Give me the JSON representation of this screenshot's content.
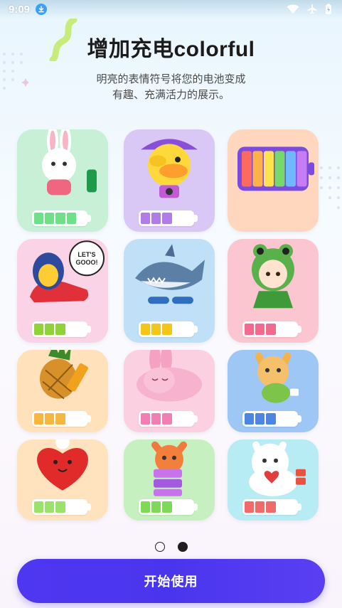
{
  "status_bar": {
    "time": "9:09",
    "icons": [
      "download-icon",
      "wifi-icon",
      "airplane-icon",
      "battery-charging-icon"
    ]
  },
  "header": {
    "title": "增加充电colorful",
    "subtitle_line1": "明亮的表情符号将您的电池变成",
    "subtitle_line2": "有趣、充满活力的展示。"
  },
  "gallery": {
    "cards": [
      {
        "name": "bunny",
        "bg": "#c8f0d6",
        "level": 0.7,
        "color": "#6fe08a"
      },
      {
        "name": "duck",
        "bg": "#d9c7f5",
        "level": 0.55,
        "color": "#b27ce8"
      },
      {
        "name": "rainbow-battery",
        "bg": "#ffd7bf",
        "level": 1.0,
        "color": "#ff7a5c"
      },
      {
        "name": "penguin-sneaker",
        "bg": "#fbd3e6",
        "level": 0.6,
        "color": "#8fd23a"
      },
      {
        "name": "shark",
        "bg": "#bfe0f7",
        "level": 0.6,
        "color": "#f6c51a"
      },
      {
        "name": "frog-girl",
        "bg": "#fbc6cf",
        "level": 0.6,
        "color": "#f26a8d"
      },
      {
        "name": "pineapple",
        "bg": "#ffe2bb",
        "level": 0.6,
        "color": "#f7b640"
      },
      {
        "name": "sleeping-bunny",
        "bg": "#fbd1e2",
        "level": 0.6,
        "color": "#f17fb4"
      },
      {
        "name": "cat-teapot",
        "bg": "#9fc7f5",
        "level": 0.6,
        "color": "#4b86e2"
      },
      {
        "name": "heart",
        "bg": "#ffe3bf",
        "level": 0.6,
        "color": "#9be26b"
      },
      {
        "name": "orange-cat",
        "bg": "#c6f0c0",
        "level": 0.6,
        "color": "#7ed957"
      },
      {
        "name": "white-cat",
        "bg": "#b8ecf5",
        "level": 0.6,
        "color": "#f06a6a"
      }
    ]
  },
  "pager": {
    "pages": 2,
    "current": 2
  },
  "start_button": {
    "label": "开始使用"
  },
  "colors": {
    "accent": "#4f37f0",
    "title": "#1b1b1b",
    "subtitle": "#4a4a4a"
  }
}
